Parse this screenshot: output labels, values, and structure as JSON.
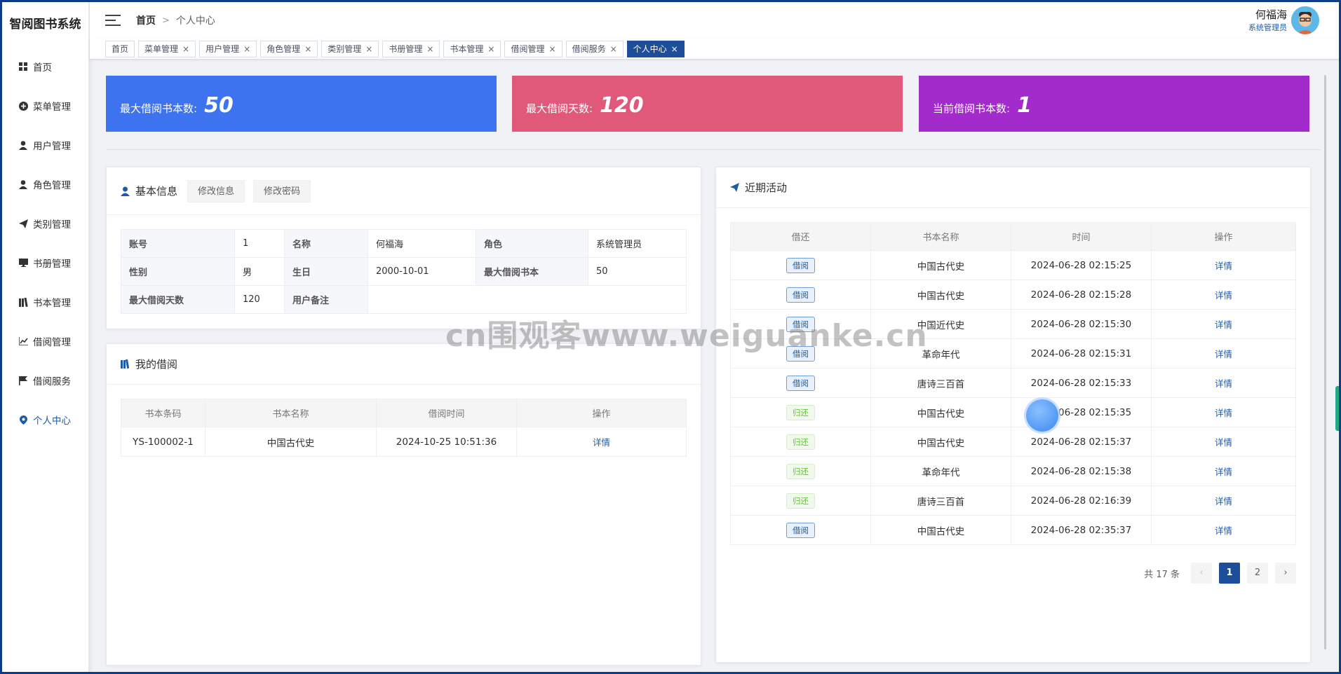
{
  "app": {
    "title": "智阅图书系统"
  },
  "sidebar": {
    "items": [
      {
        "label": "首页",
        "icon": "grid-icon"
      },
      {
        "label": "菜单管理",
        "icon": "plus-circle-icon"
      },
      {
        "label": "用户管理",
        "icon": "user-icon"
      },
      {
        "label": "角色管理",
        "icon": "user-icon"
      },
      {
        "label": "类别管理",
        "icon": "send-icon"
      },
      {
        "label": "书册管理",
        "icon": "monitor-icon"
      },
      {
        "label": "书本管理",
        "icon": "books-icon"
      },
      {
        "label": "借阅管理",
        "icon": "chart-icon"
      },
      {
        "label": "借阅服务",
        "icon": "flag-icon"
      },
      {
        "label": "个人中心",
        "icon": "location-icon"
      }
    ]
  },
  "header": {
    "breadcrumb": {
      "home": "首页",
      "sep": ">",
      "current": "个人中心"
    },
    "user": {
      "name": "何福海",
      "role": "系统管理员"
    }
  },
  "tags": [
    "首页",
    "菜单管理",
    "用户管理",
    "角色管理",
    "类别管理",
    "书册管理",
    "书本管理",
    "借阅管理",
    "借阅服务",
    "个人中心"
  ],
  "stats": [
    {
      "label": "最大借阅书本数:",
      "value": "50",
      "color": "#3e73f0"
    },
    {
      "label": "最大借阅天数:",
      "value": "120",
      "color": "#e0587a"
    },
    {
      "label": "当前借阅书本数:",
      "value": "1",
      "color": "#a32acb"
    }
  ],
  "basic_info": {
    "title": "基本信息",
    "edit_label": "修改信息",
    "pwd_label": "修改密码",
    "rows": [
      [
        "账号",
        "1",
        "名称",
        "何福海",
        "角色",
        "系统管理员"
      ],
      [
        "性别",
        "男",
        "生日",
        "2000-10-01",
        "最大借阅书本",
        "50"
      ],
      [
        "最大借阅天数",
        "120",
        "用户备注",
        ""
      ]
    ]
  },
  "my_borrow": {
    "title": "我的借阅",
    "headers": [
      "书本条码",
      "书本名称",
      "借阅时间",
      "操作"
    ],
    "rows": [
      [
        "YS-100002-1",
        "中国古代史",
        "2024-10-25 10:51:36",
        "详情"
      ]
    ]
  },
  "recent": {
    "title": "近期活动",
    "headers": [
      "借还",
      "书本名称",
      "时间",
      "操作"
    ],
    "rows": [
      [
        "借阅",
        "中国古代史",
        "2024-06-28 02:15:25",
        "详情"
      ],
      [
        "借阅",
        "中国古代史",
        "2024-06-28 02:15:28",
        "详情"
      ],
      [
        "借阅",
        "中国近代史",
        "2024-06-28 02:15:30",
        "详情"
      ],
      [
        "借阅",
        "革命年代",
        "2024-06-28 02:15:31",
        "详情"
      ],
      [
        "借阅",
        "唐诗三百首",
        "2024-06-28 02:15:33",
        "详情"
      ],
      [
        "归还",
        "中国古代史",
        "2024-06-28 02:15:35",
        "详情"
      ],
      [
        "归还",
        "中国古代史",
        "2024-06-28 02:15:37",
        "详情"
      ],
      [
        "归还",
        "革命年代",
        "2024-06-28 02:15:38",
        "详情"
      ],
      [
        "归还",
        "唐诗三百首",
        "2024-06-28 02:16:39",
        "详情"
      ],
      [
        "借阅",
        "中国古代史",
        "2024-06-28 02:35:37",
        "详情"
      ]
    ],
    "pager": {
      "total": "共 17 条",
      "prev": "‹",
      "pages": [
        "1",
        "2"
      ],
      "next": "›"
    }
  },
  "watermark": "cn围观客www.weiguanke.cn"
}
